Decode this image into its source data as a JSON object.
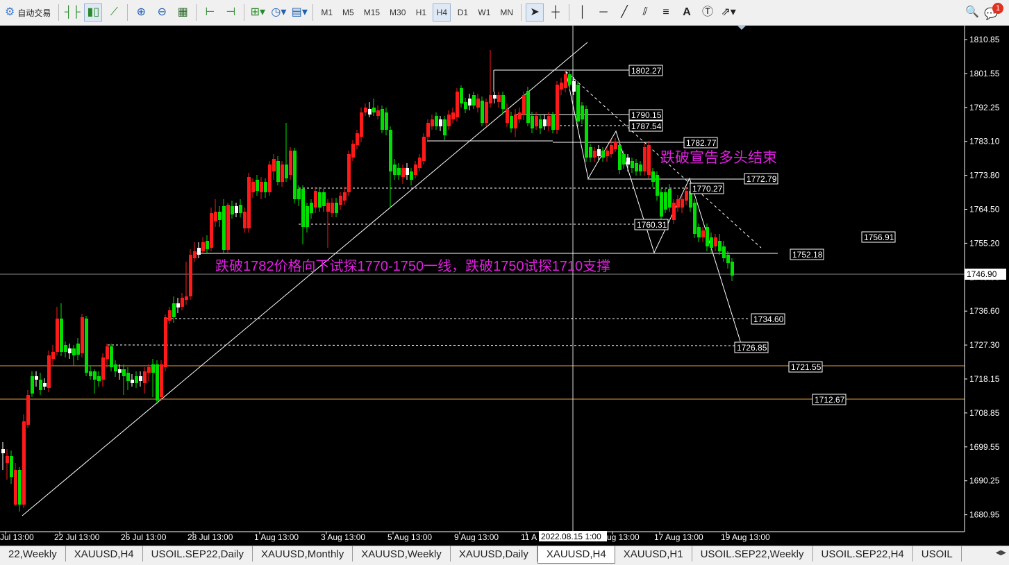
{
  "toolbar": {
    "auto_trade_label": "自动交易",
    "timeframes": [
      "M1",
      "M5",
      "M15",
      "M30",
      "H1",
      "H4",
      "D1",
      "W1",
      "MN"
    ],
    "active_timeframe": "H4",
    "notification_count": "1"
  },
  "chart": {
    "price_axis": [
      "1810.85",
      "1801.55",
      "1792.25",
      "1783.10",
      "1773.80",
      "1764.50",
      "1755.20",
      "1745.90",
      "1736.60",
      "1727.30",
      "1718.15",
      "1708.85",
      "1699.55",
      "1690.25",
      "1680.95"
    ],
    "current_price": "1746.90",
    "time_axis": [
      "Jul 13:00",
      "22 Jul 13:00",
      "26 Jul 13:00",
      "28 Jul 13:00",
      "1 Aug 13:00",
      "3 Aug 13:00",
      "5 Aug 13:00",
      "9 Aug 13:00",
      "11 A",
      "ug 13:00",
      "17 Aug 13:00",
      "19 Aug 13:00"
    ],
    "crosshair_time": "2022.08.15 1:00",
    "level_labels": [
      "1802.27",
      "1790.15",
      "1787.54",
      "1782.77",
      "1772.79",
      "1770.27",
      "1760.31",
      "1756.91",
      "1752.18",
      "1734.60",
      "1726.85",
      "1721.55",
      "1712.67"
    ],
    "annotation_top": "跌破宣告多头结束",
    "annotation_main": "跌破1782价格向下试探1770-1750一线，跌破1750试探1710支撑"
  },
  "tabs": [
    "22,Weekly",
    "XAUUSD,H4",
    "USOIL.SEP22,Daily",
    "XAUUSD,Monthly",
    "XAUUSD,Weekly",
    "XAUUSD,Daily",
    "XAUUSD,H4",
    "XAUUSD,H1",
    "USOIL.SEP22,Weekly",
    "USOIL.SEP22,H4",
    "USOIL"
  ],
  "active_tab_index": 6,
  "colors": {
    "bull": "#00e000",
    "bear": "#ff1a1a",
    "annotation": "#e020e0",
    "orange_level": "#e8a040"
  }
}
